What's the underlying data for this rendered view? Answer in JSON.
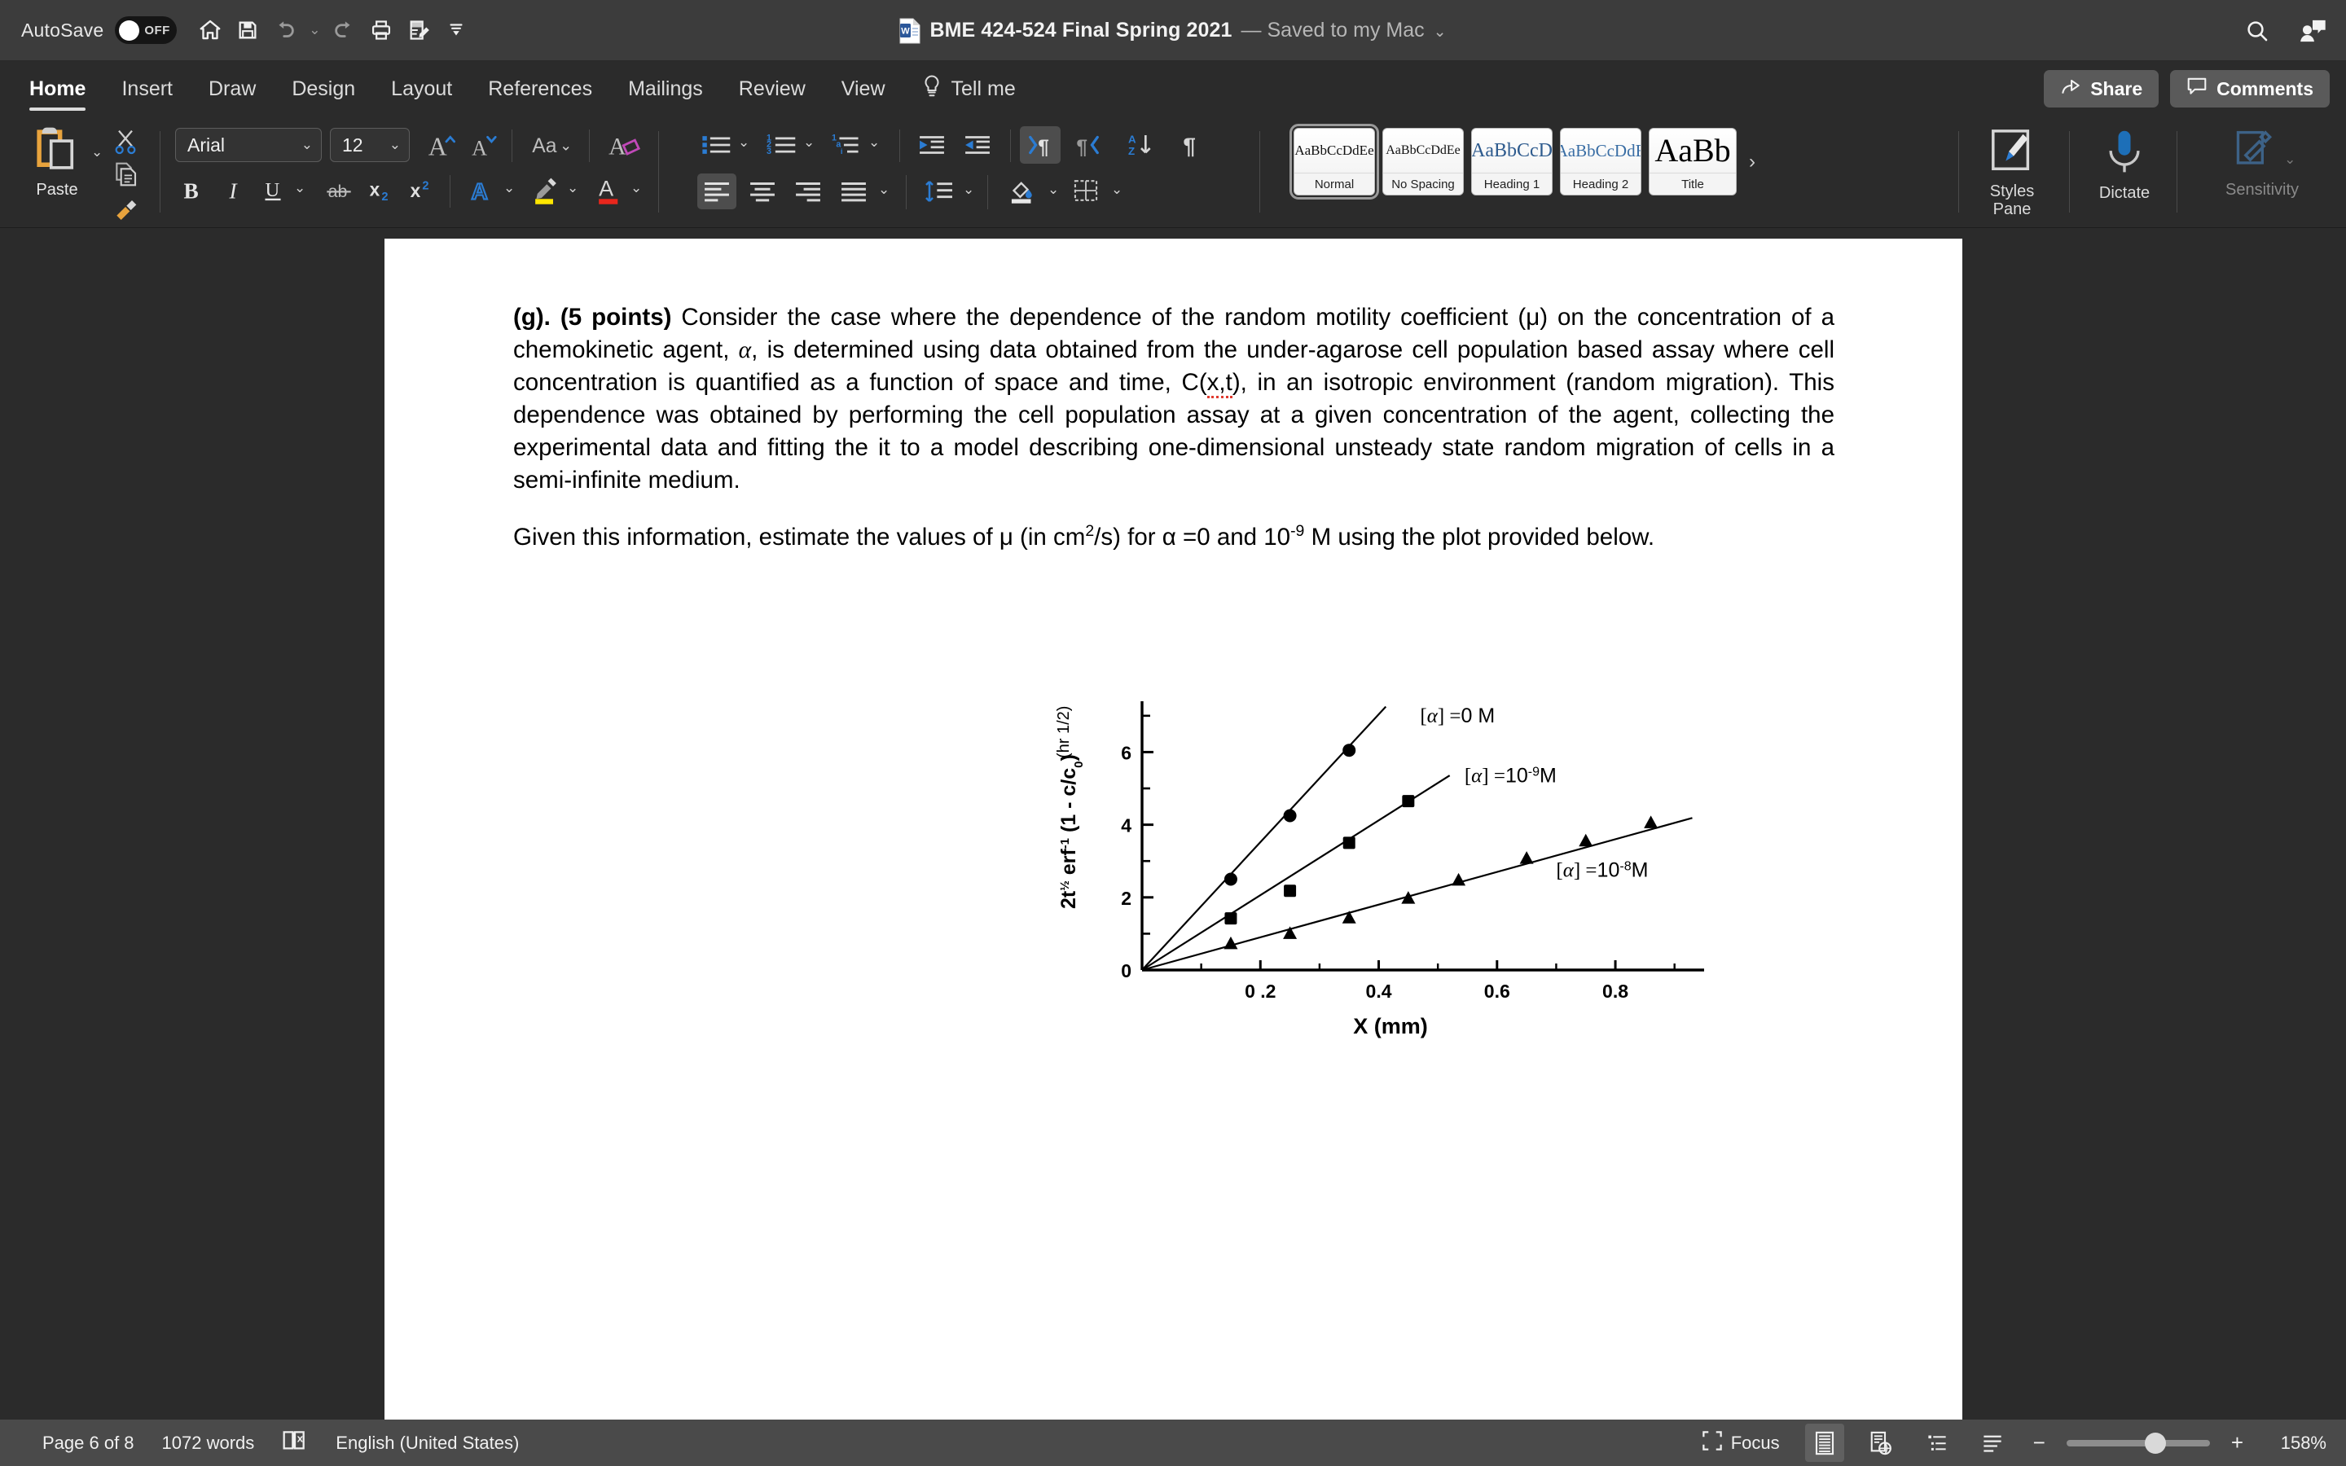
{
  "titlebar": {
    "autosave_label": "AutoSave",
    "autosave_state": "OFF",
    "doc_title": "BME 424-524 Final Spring 2021",
    "doc_saved_state": "— Saved to my Mac",
    "quick_access": [
      {
        "name": "home-icon",
        "tooltip": "Home"
      },
      {
        "name": "save-icon",
        "tooltip": "Save"
      },
      {
        "name": "undo-icon",
        "tooltip": "Undo"
      },
      {
        "name": "redo-icon",
        "tooltip": "Redo"
      },
      {
        "name": "print-icon",
        "tooltip": "Print"
      },
      {
        "name": "track-changes-icon",
        "tooltip": "Track Changes"
      },
      {
        "name": "customize-toolbar-icon",
        "tooltip": "Customize Toolbar"
      }
    ],
    "right_icons": [
      {
        "name": "search-icon"
      },
      {
        "name": "account-comments-icon"
      }
    ]
  },
  "ribbon_tabs": {
    "items": [
      "Home",
      "Insert",
      "Draw",
      "Design",
      "Layout",
      "References",
      "Mailings",
      "Review",
      "View"
    ],
    "active": "Home",
    "tell_me": "Tell me",
    "share": "Share",
    "comments": "Comments"
  },
  "ribbon": {
    "paste_label": "Paste",
    "font_name": "Arial",
    "font_size": "12",
    "styles_pane_label_line1": "Styles",
    "styles_pane_label_line2": "Pane",
    "dictate_label": "Dictate",
    "sensitivity_label": "Sensitivity",
    "gallery_more": "›",
    "style_gallery": [
      {
        "preview": "AaBbCcDdEe",
        "name": "Normal",
        "selected": true,
        "kind": "body"
      },
      {
        "preview": "AaBbCcDdEe",
        "name": "No Spacing",
        "selected": false,
        "kind": "body"
      },
      {
        "preview": "AaBbCcD",
        "name": "Heading 1",
        "selected": false,
        "kind": "h1"
      },
      {
        "preview": "AaBbCcDdE",
        "name": "Heading 2",
        "selected": false,
        "kind": "h2"
      },
      {
        "preview": "AaBb",
        "name": "Title",
        "selected": false,
        "kind": "title"
      }
    ],
    "icons": [
      "cut-icon",
      "copy-icon",
      "format-painter-icon",
      "grow-font-icon",
      "shrink-font-icon",
      "change-case-icon",
      "clear-formatting-icon",
      "bold-icon",
      "italic-icon",
      "underline-icon",
      "strikethrough-icon",
      "subscript-icon",
      "superscript-icon",
      "text-effects-icon",
      "text-highlight-icon",
      "font-color-icon",
      "bullet-list-icon",
      "numbered-list-icon",
      "multilevel-list-icon",
      "decrease-indent-icon",
      "increase-indent-icon",
      "rtl-paragraph-icon",
      "sort-icon",
      "show-marks-icon",
      "align-left-icon",
      "align-center-icon",
      "align-right-icon",
      "justify-icon",
      "line-spacing-icon",
      "shading-icon",
      "borders-icon"
    ],
    "accent_colors": {
      "word_blue": "#2b7cd3",
      "paste_orange": "#e8a33d",
      "highlight_yellow": "#ffe600",
      "font_red": "#e8261c",
      "text_effects_magenta": "#c049b8"
    }
  },
  "document": {
    "para_bold_lead": "(g). (5 points)",
    "para_rest_a": " Consider the case where the dependence of the random motility coefficient (μ) on the concentration of a chemokinetic agent, ",
    "alpha_1": "α",
    "para_rest_b": ", is determined using data obtained from the under-agarose cell population based assay where cell concentration is quantified as a function of space and time, C(",
    "misspelled": "x,t",
    "para_rest_c": "), in an isotropic environment (random migration).  This dependence was obtained by performing the cell population assay at a given concentration of the agent, collecting the experimental data and fitting the it to a model describing one-dimensional unsteady state random migration of cells in a semi-infinite medium.",
    "para2_a": "Given this information, estimate the values of μ (in cm",
    "para2_sup1": "2",
    "para2_b": "/s) for α =0 and 10",
    "para2_sup2": "-9",
    "para2_c": " M using the plot provided below."
  },
  "chart_data": {
    "type": "scatter",
    "title": "",
    "xlabel": "X (mm)",
    "ylabel": "2t ½ erf ⁻¹ (1 - c/c₀)",
    "ylabel_units": "(hr 1/2)",
    "xlim": [
      0,
      0.95
    ],
    "ylim": [
      0,
      7.4
    ],
    "xticks": [
      0.2,
      0.4,
      0.6,
      0.8
    ],
    "xticklabels": [
      "0 .2",
      "0.4",
      "0.6",
      "0.8"
    ],
    "yticks": [
      0,
      2,
      4,
      6
    ],
    "yticklabels": [
      "0",
      "2",
      "4",
      "6"
    ],
    "minor_yticks": [
      1,
      3,
      5,
      7
    ],
    "minor_xticks": [
      0.1,
      0.3,
      0.5,
      0.7,
      0.9
    ],
    "grid": false,
    "legend": "annotations",
    "series": [
      {
        "name": "[α] =0 M",
        "marker": "circle",
        "label_x": 0.47,
        "label_y": 7.0,
        "fit_slope": 17.6,
        "points": [
          {
            "x": 0.15,
            "y": 2.5
          },
          {
            "x": 0.25,
            "y": 4.25
          },
          {
            "x": 0.35,
            "y": 6.05
          }
        ]
      },
      {
        "name": "[α] =10⁻⁹M",
        "marker": "square",
        "label_x": 0.545,
        "label_y": 5.35,
        "fit_slope": 10.3,
        "points": [
          {
            "x": 0.15,
            "y": 1.42
          },
          {
            "x": 0.25,
            "y": 2.18
          },
          {
            "x": 0.35,
            "y": 3.5
          },
          {
            "x": 0.45,
            "y": 4.65
          }
        ]
      },
      {
        "name": "[α] =10⁻⁸M",
        "marker": "triangle",
        "label_x": 0.7,
        "label_y": 2.75,
        "fit_slope": 4.5,
        "points": [
          {
            "x": 0.15,
            "y": 0.72
          },
          {
            "x": 0.25,
            "y": 1.0
          },
          {
            "x": 0.35,
            "y": 1.43
          },
          {
            "x": 0.45,
            "y": 1.97
          },
          {
            "x": 0.535,
            "y": 2.47
          },
          {
            "x": 0.65,
            "y": 3.07
          },
          {
            "x": 0.75,
            "y": 3.55
          },
          {
            "x": 0.86,
            "y": 4.05
          }
        ]
      }
    ]
  },
  "statusbar": {
    "page": "Page 6 of 8",
    "words": "1072 words",
    "proofing_icon": "proofing-errors-icon",
    "language": "English (United States)",
    "focus": "Focus",
    "view_icons": [
      "print-layout-icon",
      "web-layout-icon",
      "outline-icon",
      "draft-icon"
    ],
    "zoom_out": "−",
    "zoom_in": "+",
    "zoom_percent": "158%"
  }
}
